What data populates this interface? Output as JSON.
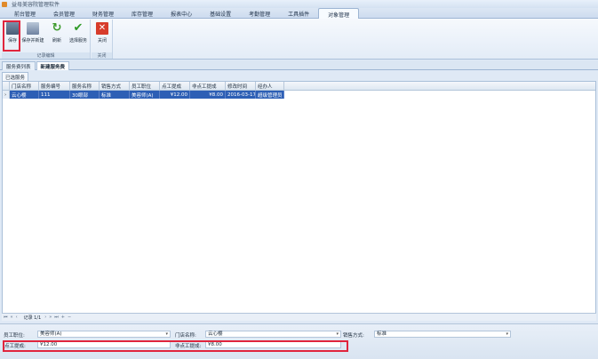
{
  "window": {
    "title": "益母美容院管理软件"
  },
  "ribbon_tabs": [
    "前台管理",
    "会员管理",
    "财务管理",
    "库存管理",
    "报表中心",
    "基础设置",
    "考勤管理",
    "工具插件",
    "对象管理"
  ],
  "active_ribbon_tab": "对象管理",
  "ribbon": {
    "group1_label": "记录编辑",
    "group2_label": "关闭",
    "buttons": {
      "save": "保存",
      "save_new": "保存并新建",
      "refresh": "刷新",
      "select_service": "选择服务",
      "close": "关闭"
    }
  },
  "doc_tabs": [
    "服务费列表",
    "新建服务费"
  ],
  "active_doc_tab": "新建服务费",
  "sub_tab": "已选服务",
  "grid": {
    "columns": [
      "门店名称",
      "服务编号",
      "服务名称",
      "销售方式",
      "员工职位",
      "点工提成",
      "非点工提成",
      "修改时间",
      "经办人"
    ],
    "rows": [
      [
        "云心樱",
        "111",
        "30眼部",
        "标准",
        "美容师(A)",
        "¥12.00",
        "¥8.00",
        "2016-03-17",
        "超级管理员"
      ]
    ]
  },
  "navigator": {
    "record": "记录 1/1"
  },
  "form": {
    "staff_position_label": "员工职位:",
    "staff_position_value": "美容师(A)",
    "store_name_label": "门店名称:",
    "store_name_value": "云心樱",
    "sales_method_label": "销售方式:",
    "sales_method_value": "标准",
    "point_commission_label": "点工提成:",
    "point_commission_value": "¥12.00",
    "non_point_commission_label": "非点工提成:",
    "non_point_commission_value": "¥8.00"
  },
  "colors": {
    "highlight": "#e0253d",
    "selected_row": "#2d5fb5"
  }
}
